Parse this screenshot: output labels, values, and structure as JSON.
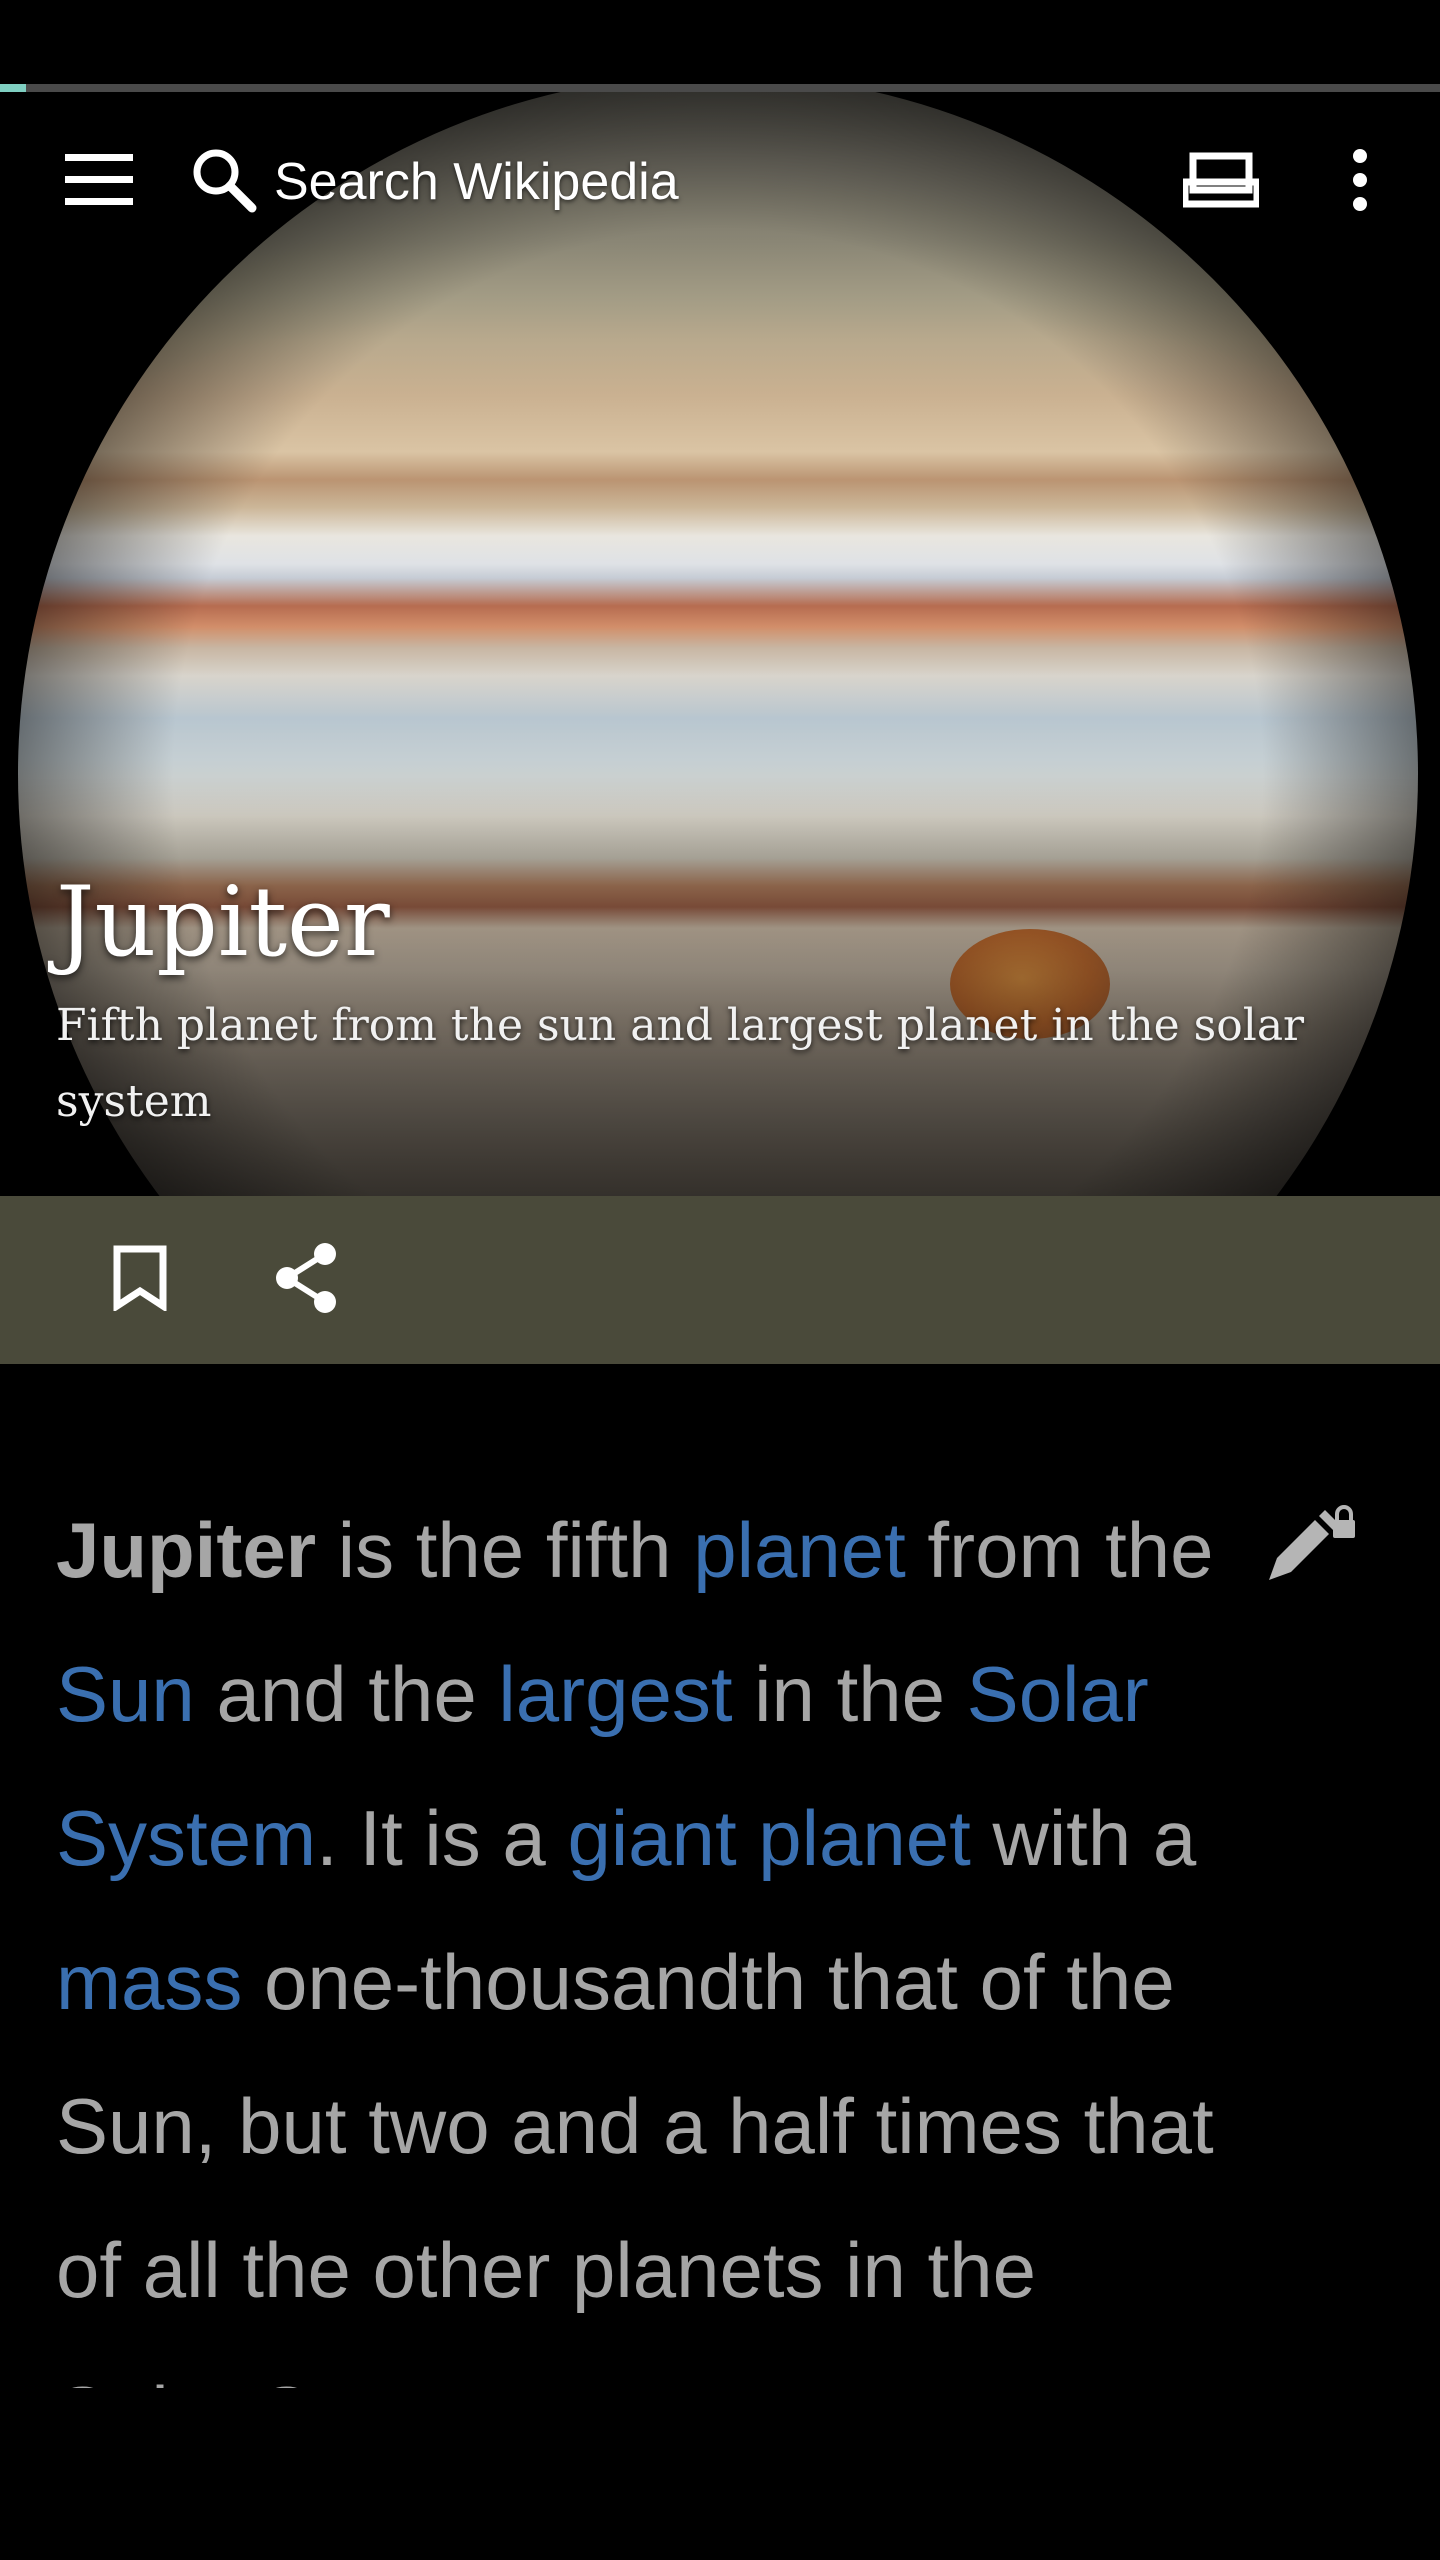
{
  "progress": 0.018,
  "colors": {
    "link": "#3a6fb0",
    "text": "#a6a6a6",
    "action_bar": "#4a4a3a",
    "progress": "#7fcfc1"
  },
  "toolbar": {
    "menu_icon": "hamburger-menu-icon",
    "search_icon": "search-icon",
    "search_placeholder": "Search Wikipedia",
    "tabs_icon": "tabs-icon",
    "overflow_icon": "more-vert-icon"
  },
  "article": {
    "title": "Jupiter",
    "description": "Fifth planet from the sun and largest planet in the solar system"
  },
  "actions": {
    "bookmark_icon": "bookmark-icon",
    "share_icon": "share-icon"
  },
  "lead": {
    "edit_icon": "edit-locked-icon",
    "segments": [
      {
        "t": "Jupiter",
        "kind": "bold"
      },
      {
        "t": " is the fifth ",
        "kind": "text"
      },
      {
        "t": "planet",
        "kind": "link"
      },
      {
        "t": " from the ",
        "kind": "text"
      },
      {
        "t": "Sun",
        "kind": "link"
      },
      {
        "t": " and the ",
        "kind": "text"
      },
      {
        "t": "largest",
        "kind": "link"
      },
      {
        "t": " in the ",
        "kind": "text"
      },
      {
        "t": "Solar System",
        "kind": "link"
      },
      {
        "t": ". It is a ",
        "kind": "text"
      },
      {
        "t": "giant planet",
        "kind": "link"
      },
      {
        "t": " with a ",
        "kind": "text"
      },
      {
        "t": "mass",
        "kind": "link"
      },
      {
        "t": " one-thousandth that of the Sun, but two and a half times that of all the other planets in the Solar System",
        "kind": "text"
      }
    ]
  }
}
